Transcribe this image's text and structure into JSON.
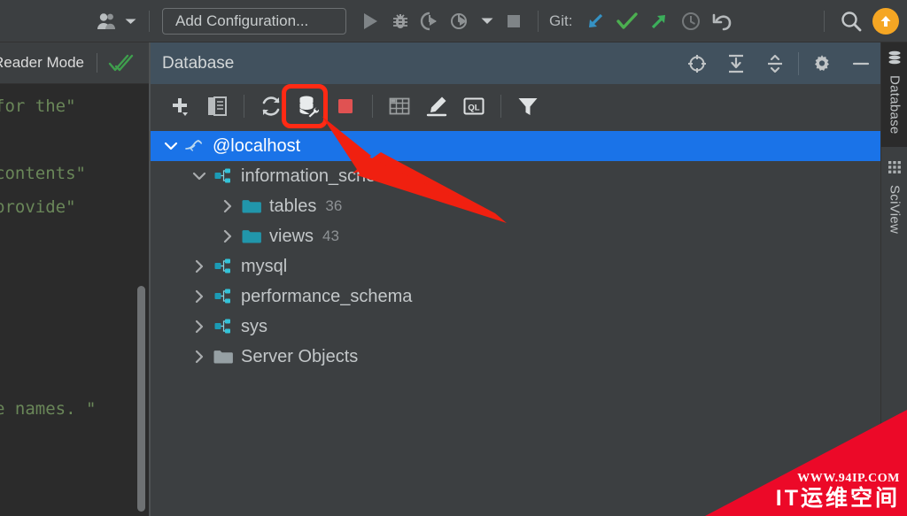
{
  "top_toolbar": {
    "avatar_icon": "user-avatar-icon",
    "avatar_dropdown_icon": "chevron-down-icon",
    "run_configuration_label": "Add Configuration...",
    "run_icon": "run-play-icon",
    "debug_icon": "debug-bug-icon",
    "coverage_icon": "run-with-coverage-icon",
    "profile_icon": "profile-icon",
    "profile_dropdown_icon": "chevron-down-icon",
    "stop_icon": "stop-square-icon",
    "git_label": "Git:",
    "git_update_icon": "update-project-arrow-icon",
    "git_commit_icon": "commit-checkmark-icon",
    "git_push_icon": "push-arrow-icon",
    "git_history_icon": "history-clock-icon",
    "git_rollback_icon": "rollback-undo-icon",
    "search_icon": "search-magnifier-icon",
    "update_button_icon": "update-available-up-arrow-icon"
  },
  "editor": {
    "reader_mode_label": "Reader Mode",
    "reader_mode_check_icon": "green-double-check-icon",
    "code_lines": [
      "for the\"",
      "",
      "contents\"",
      "provide\"",
      "",
      "",
      "",
      "",
      "",
      "e names. \""
    ],
    "scrollbar_name": "editor-vertical-scrollbar"
  },
  "database_panel": {
    "title": "Database",
    "header_actions": [
      {
        "name": "scroll-from-source-icon",
        "label": ""
      },
      {
        "name": "expand-all-icon",
        "label": ""
      },
      {
        "name": "collapse-all-icon",
        "label": ""
      },
      {
        "name": "settings-gear-icon",
        "label": ""
      },
      {
        "name": "minimize-icon",
        "label": ""
      }
    ],
    "toolbar_actions": [
      {
        "name": "add-plus-icon",
        "label": ""
      },
      {
        "name": "duplicate-copy-icon",
        "label": ""
      },
      {
        "name": "refresh-sync-icon",
        "label": ""
      },
      {
        "name": "database-properties-wrench-icon",
        "label": "",
        "highlighted": true
      },
      {
        "name": "stop-red-square-icon",
        "label": ""
      },
      {
        "name": "open-table-editor-icon",
        "label": ""
      },
      {
        "name": "modify-pencil-icon",
        "label": ""
      },
      {
        "name": "jump-to-query-console-icon",
        "label": "QL"
      },
      {
        "name": "filter-funnel-icon",
        "label": ""
      }
    ],
    "tree": [
      {
        "label": "@localhost",
        "icon": "mysql-dolphin-icon",
        "twisty": "expanded",
        "indent": 0,
        "selected": true,
        "count": ""
      },
      {
        "label": "information_schema",
        "icon": "schema-icon",
        "twisty": "expanded",
        "indent": 1,
        "selected": false,
        "count": ""
      },
      {
        "label": "tables",
        "icon": "folder-teal-icon",
        "twisty": "collapsed",
        "indent": 2,
        "selected": false,
        "count": "36"
      },
      {
        "label": "views",
        "icon": "folder-teal-icon",
        "twisty": "collapsed",
        "indent": 2,
        "selected": false,
        "count": "43"
      },
      {
        "label": "mysql",
        "icon": "schema-icon",
        "twisty": "collapsed",
        "indent": 1,
        "selected": false,
        "count": ""
      },
      {
        "label": "performance_schema",
        "icon": "schema-icon",
        "twisty": "collapsed",
        "indent": 1,
        "selected": false,
        "count": ""
      },
      {
        "label": "sys",
        "icon": "schema-icon",
        "twisty": "collapsed",
        "indent": 1,
        "selected": false,
        "count": ""
      },
      {
        "label": "Server Objects",
        "icon": "folder-gray-icon",
        "twisty": "collapsed",
        "indent": 1,
        "selected": false,
        "count": ""
      }
    ]
  },
  "right_tabs": [
    {
      "label": "Database",
      "icon": "database-stack-icon",
      "active": true
    },
    {
      "label": "SciView",
      "icon": "sciview-grid-icon",
      "active": false
    }
  ],
  "annotation": {
    "arrow_name": "red-pointer-arrow",
    "arrow_color": "#f02010",
    "highlight_color": "#ff2a14",
    "highlight_target": "database-properties-wrench-icon"
  },
  "watermark": {
    "url_text": "WWW.94IP.COM",
    "brand_text": "IT运维空间",
    "color": "#ec0928"
  },
  "colors": {
    "app_background": "#3c3f41",
    "editor_background": "#2b2b2b",
    "panel_header": "#41515e",
    "selection_blue": "#1a73e8",
    "accent_orange": "#f5a623",
    "tree_text": "#c3c7c9"
  }
}
